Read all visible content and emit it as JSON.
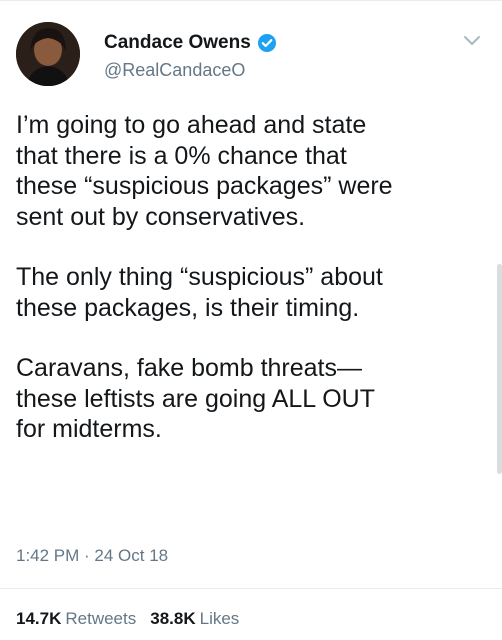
{
  "author": {
    "display_name": "Candace Owens",
    "handle": "@RealCandaceO",
    "verified": true
  },
  "tweet": {
    "paragraphs": [
      "I’m going to go ahead and state\nthat there is a 0% chance that\nthese “suspicious packages” were\nsent out by conservatives.",
      "The only thing “suspicious” about\nthese packages, is their timing.",
      "Caravans, fake bomb threats—\nthese leftists are going ALL OUT\nfor midterms."
    ],
    "timestamp": "1:42 PM · 24 Oct 18"
  },
  "stats": {
    "retweets_count": "14.7K",
    "retweets_label": "Retweets",
    "likes_count": "38.8K",
    "likes_label": "Likes"
  },
  "colors": {
    "verified_blue": "#1da1f2",
    "secondary_text": "#657786",
    "primary_text": "#14171a"
  }
}
